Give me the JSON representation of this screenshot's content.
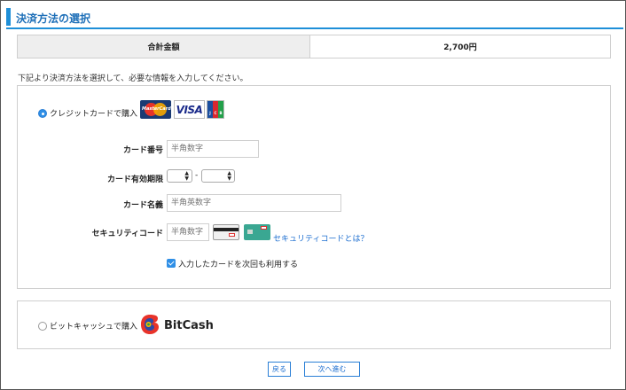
{
  "header": {
    "title": "決済方法の選択"
  },
  "total": {
    "label": "合計金額",
    "value": "2,700円"
  },
  "instruction": "下記より決済方法を選択して、必要な情報を入力してください。",
  "credit_card": {
    "option_label": "クレジットカードで購入",
    "selected": true,
    "brand_logos": [
      "MasterCard",
      "VISA",
      "JCB"
    ],
    "card_number": {
      "label": "カード番号",
      "placeholder": "半角数字"
    },
    "expiry": {
      "label": "カード有効期限",
      "separator": "-",
      "month_value": "",
      "year_value": ""
    },
    "card_name": {
      "label": "カード名義",
      "placeholder": "半角英数字"
    },
    "security_code": {
      "label": "セキュリティコード",
      "placeholder": "半角数字",
      "help_link": "セキュリティコードとは？"
    },
    "remember": {
      "label": "入力したカードを次回も利用する",
      "checked": true
    }
  },
  "bitcash": {
    "option_label": "ビットキャッシュで購入",
    "selected": false,
    "logo_text": "BitCash"
  },
  "buttons": {
    "back": "戻る",
    "next": "次へ進む"
  },
  "colors": {
    "accent": "#1e8fd8",
    "link": "#1e6fd0",
    "border": "#cfcfcf",
    "label_bg": "#eeeeee"
  },
  "icons": {
    "card_back": "card-back-cvv-icon",
    "card_front": "card-front-cvv-icon",
    "checkbox": "checkbox-checked-icon",
    "radio_selected": "radio-selected-icon",
    "radio_unselected": "radio-unselected-icon"
  }
}
